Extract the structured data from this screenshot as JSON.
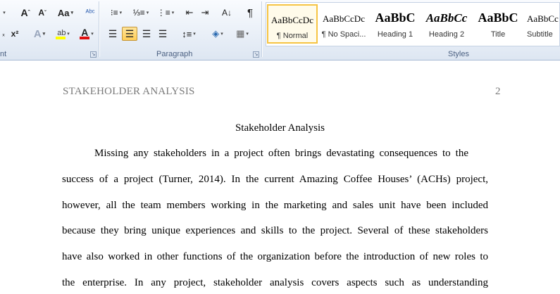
{
  "ribbon": {
    "font_group_label": "nt",
    "paragraph_group_label": "Paragraph",
    "styles_group_label": "Styles",
    "styles": [
      {
        "preview": "AaBbCcDc",
        "name": "¶ Normal"
      },
      {
        "preview": "AaBbCcDc",
        "name": "¶ No Spaci..."
      },
      {
        "preview": "AaBbC",
        "name": "Heading 1"
      },
      {
        "preview": "AaBbCc",
        "name": "Heading 2"
      },
      {
        "preview": "AaBbC",
        "name": "Title"
      },
      {
        "preview": "AaBbCc",
        "name": "Subtitle"
      }
    ]
  },
  "document": {
    "header_title": "STAKEHOLDER ANALYSIS",
    "page_number": "2",
    "title": "Stakeholder Analysis",
    "lines": [
      "Missing any stakeholders in a project often brings devastating consequences to the",
      "success of a project (Turner, 2014). In the current Amazing Coffee Houses’ (ACHs) project,",
      "however, all the team members working in the marketing and sales unit have been included",
      "because they bring unique experiences and skills to the project. Several of these stakeholders",
      "have also worked in other functions of the organization before the introduction of new roles to",
      "the enterprise. In any project, stakeholder analysis covers aspects such as understanding"
    ]
  }
}
